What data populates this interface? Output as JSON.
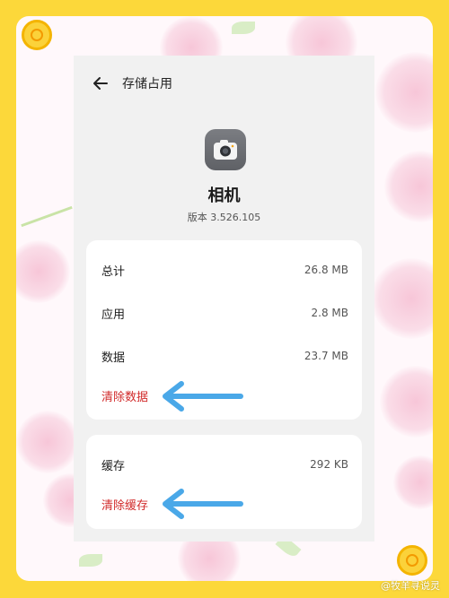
{
  "header": {
    "title": "存储占用",
    "back_icon": "arrow-left-icon"
  },
  "app": {
    "name": "相机",
    "version": "版本 3.526.105",
    "icon": "camera-icon"
  },
  "storage": {
    "items": [
      {
        "label": "总计",
        "value": "26.8 MB"
      },
      {
        "label": "应用",
        "value": "2.8 MB"
      },
      {
        "label": "数据",
        "value": "23.7 MB"
      }
    ],
    "clear_data_label": "清除数据"
  },
  "cache": {
    "label": "缓存",
    "value": "292 KB",
    "clear_cache_label": "清除缓存"
  },
  "watermark": "@牧羊寻说灵",
  "colors": {
    "accent_red": "#d12a2a",
    "arrow_blue": "#4aa8e8",
    "frame_yellow": "#fcd83a"
  }
}
